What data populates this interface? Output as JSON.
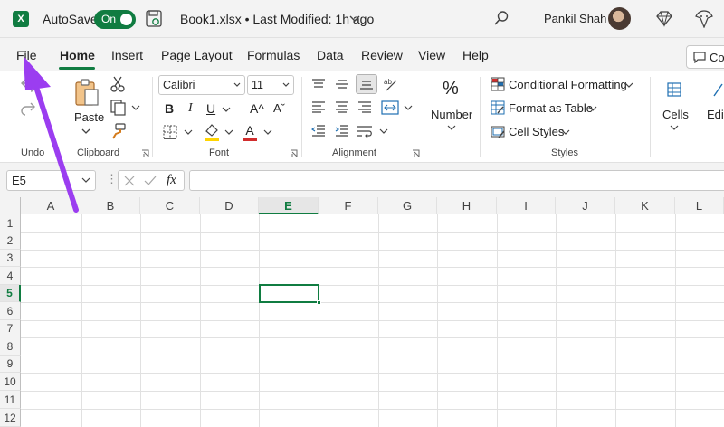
{
  "titlebar": {
    "app_logo": "X",
    "autosave_label": "AutoSave",
    "toggle_label": "On",
    "doc_title": "Book1.xlsx • Last Modified: 1h ago",
    "user_name": "Pankil Shah"
  },
  "menu": {
    "tabs": [
      "File",
      "Home",
      "Insert",
      "Page Layout",
      "Formulas",
      "Data",
      "Review",
      "View",
      "Help"
    ],
    "active": "Home",
    "comments_label": "Co"
  },
  "ribbon": {
    "undo_group": "Undo",
    "clipboard": {
      "paste": "Paste",
      "group": "Clipboard"
    },
    "font": {
      "family": "Calibri",
      "size": "11",
      "bold": "B",
      "italic": "I",
      "underline": "U",
      "grow": "A^",
      "shrink": "Aˇ",
      "color_a": "A",
      "group": "Font"
    },
    "alignment": {
      "group": "Alignment"
    },
    "number": {
      "label": "Number"
    },
    "styles": {
      "conditional": "Conditional Formatting",
      "format_table": "Format as Table",
      "cell_styles": "Cell Styles",
      "group": "Styles"
    },
    "cells": {
      "label": "Cells"
    },
    "editing": {
      "label": "Edi"
    }
  },
  "formula_bar": {
    "name_box": "E5",
    "fx": "fx"
  },
  "grid": {
    "columns": [
      "A",
      "B",
      "C",
      "D",
      "E",
      "F",
      "G",
      "H",
      "I",
      "J",
      "K",
      "L"
    ],
    "rows": [
      "1",
      "2",
      "3",
      "4",
      "5",
      "6",
      "7",
      "8",
      "9",
      "10",
      "11",
      "12"
    ],
    "selected_col": "E",
    "selected_row": "5"
  },
  "colors": {
    "accent": "#107c41",
    "annotation_arrow": "#9b3df0"
  }
}
